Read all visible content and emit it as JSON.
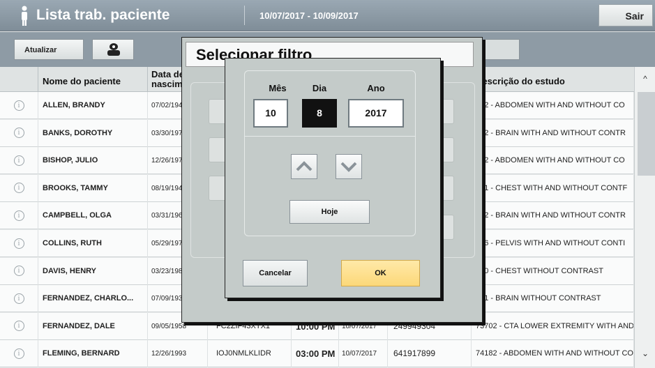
{
  "header": {
    "title": "Lista trab. paciente",
    "date_range": "10/07/2017 - 10/09/2017",
    "exit_label": "Sair"
  },
  "toolbar": {
    "refresh_label": "Atualizar"
  },
  "table": {
    "columns": [
      "Nome do paciente",
      "Data de nascimento",
      "Descrição do estudo"
    ],
    "rows": [
      {
        "name": "ALLEN, BRANDY",
        "dob": "07/02/194",
        "id": "",
        "time": "",
        "date": "",
        "acc": "",
        "desc": "182 - ABDOMEN WITH AND WITHOUT CO"
      },
      {
        "name": "BANKS, DOROTHY",
        "dob": "03/30/197",
        "id": "",
        "time": "",
        "date": "",
        "acc": "",
        "desc": "552 - BRAIN WITH AND WITHOUT CONTR"
      },
      {
        "name": "BISHOP, JULIO",
        "dob": "12/26/197",
        "id": "",
        "time": "",
        "date": "",
        "acc": "",
        "desc": "182 - ABDOMEN WITH AND WITHOUT CO"
      },
      {
        "name": "BROOKS, TAMMY",
        "dob": "08/19/194",
        "id": "",
        "time": "",
        "date": "",
        "acc": "",
        "desc": "551 - CHEST WITH AND WITHOUT CONTF"
      },
      {
        "name": "CAMPBELL, OLGA",
        "dob": "03/31/196",
        "id": "",
        "time": "",
        "date": "",
        "acc": "",
        "desc": "552 - BRAIN WITH AND WITHOUT CONTR"
      },
      {
        "name": "COLLINS, RUTH",
        "dob": "05/29/197",
        "id": "",
        "time": "",
        "date": "",
        "acc": "",
        "desc": "196 - PELVIS WITH AND WITHOUT CONTI"
      },
      {
        "name": "DAVIS, HENRY",
        "dob": "03/23/198",
        "id": "",
        "time": "",
        "date": "",
        "acc": "",
        "desc": "550 - CHEST WITHOUT CONTRAST"
      },
      {
        "name": "FERNANDEZ, CHARLO...",
        "dob": "07/09/193",
        "id": "",
        "time": "",
        "date": "",
        "acc": "",
        "desc": "551 - BRAIN WITHOUT CONTRAST"
      },
      {
        "name": "FERNANDEZ, DALE",
        "dob": "09/05/1958",
        "id": "FC2ZIF43XTX1",
        "time": "10:00 PM",
        "date": "10/07/2017",
        "acc": "249949304",
        "desc": "73702 - CTA LOWER EXTREMITY WITH AND"
      },
      {
        "name": "FLEMING, BERNARD",
        "dob": "12/26/1993",
        "id": "IOJ0NMLKLIDR",
        "time": "03:00 PM",
        "date": "10/07/2017",
        "acc": "641917899",
        "desc": "74182 - ABDOMEN WITH AND WITHOUT CO"
      }
    ]
  },
  "filter_dialog": {
    "title": "Selecionar filtro"
  },
  "date_dialog": {
    "month_label": "Mês",
    "day_label": "Dia",
    "year_label": "Ano",
    "month": "10",
    "day": "8",
    "year": "2017",
    "today_label": "Hoje",
    "cancel_label": "Cancelar",
    "ok_label": "OK"
  }
}
